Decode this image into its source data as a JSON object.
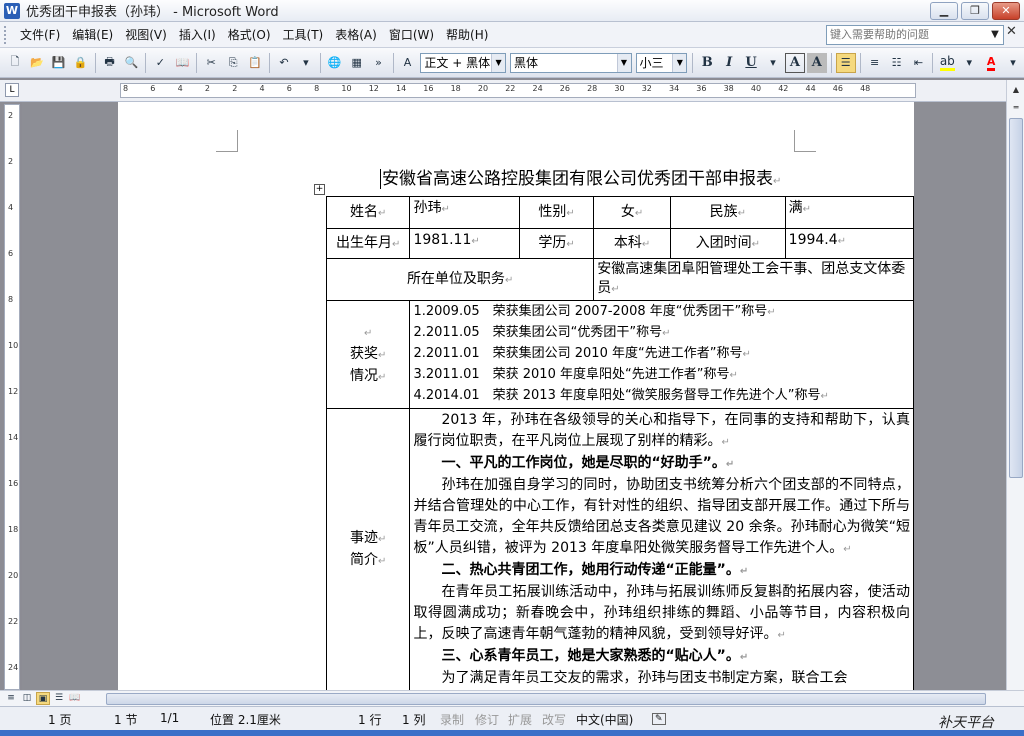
{
  "window": {
    "title": "优秀团干申报表（孙玮） - Microsoft Word",
    "app_icon": "W"
  },
  "menu": [
    "文件(F)",
    "编辑(E)",
    "视图(V)",
    "插入(I)",
    "格式(O)",
    "工具(T)",
    "表格(A)",
    "窗口(W)",
    "帮助(H)"
  ],
  "help_placeholder": "键入需要帮助的问题",
  "toolbar": {
    "style": "正文 + 黑体",
    "font": "黑体",
    "size": "小三",
    "bold": "B",
    "italic": "I",
    "underline": "U",
    "char_border": "A",
    "char_shade": "A",
    "highlight_color": "#ffff00",
    "font_color": "#ff0000"
  },
  "ruler": {
    "h_ticks": [
      "8",
      "6",
      "4",
      "2",
      "2",
      "4",
      "6",
      "8",
      "10",
      "12",
      "14",
      "16",
      "18",
      "20",
      "22",
      "24",
      "26",
      "28",
      "30",
      "32",
      "34",
      "36",
      "38",
      "40",
      "42",
      "44",
      "46",
      "48"
    ],
    "v_ticks": [
      "2",
      "2",
      "4",
      "6",
      "8",
      "10",
      "12",
      "14",
      "16",
      "18",
      "20",
      "22",
      "24"
    ],
    "tab_selector": "L"
  },
  "doc": {
    "title": "安徽省高速公路控股集团有限公司优秀团干部申报表",
    "label_name": "姓名",
    "name": "孙玮",
    "label_gender": "性别",
    "gender": "女",
    "label_ethnic": "民族",
    "ethnic": "满",
    "label_birth": "出生年月",
    "birth": "1981.11",
    "label_edu": "学历",
    "edu": "本科",
    "label_join": "入团时间",
    "join": "1994.4",
    "label_unit": "所在单位及职务",
    "unit": "安徽高速集团阜阳管理处工会干事、团总支文体委员",
    "label_awards_1": "获奖",
    "label_awards_2": "情况",
    "awards": [
      "1.2009.05　荣获集团公司 2007-2008 年度“优秀团干”称号",
      "2.2011.05　荣获集团公司“优秀团干”称号",
      "2.2011.01　荣获集团公司 2010 年度“先进工作者”称号",
      "3.2011.01　荣获 2010 年度阜阳处“先进工作者”称号",
      "4.2014.01　荣获 2013 年度阜阳处“微笑服务督导工作先进个人”称号"
    ],
    "label_story_1": "事迹",
    "label_story_2": "简介",
    "story": {
      "p1": "2013 年，孙玮在各级领导的关心和指导下，在同事的支持和帮助下，认真履行岗位职责，在平凡岗位上展现了别样的精彩。",
      "h1": "一、平凡的工作岗位，她是尽职的“好助手”。",
      "p2": "孙玮在加强自身学习的同时，协助团支书统筹分析六个团支部的不同特点，并结合管理处的中心工作，有针对性的组织、指导团支部开展工作。通过下所与青年员工交流，全年共反馈给团总支各类意见建议 20 余条。孙玮耐心为微笑“短板”人员纠错，被评为 2013 年度阜阳处微笑服务督导工作先进个人。",
      "h2": "二、热心共青团工作，她用行动传递“正能量”。",
      "p3": "在青年员工拓展训练活动中，孙玮与拓展训练师反复斟酌拓展内容，使活动取得圆满成功；新春晚会中，孙玮组织排练的舞蹈、小品等节目，内容积极向上，反映了高速青年朝气蓬勃的精神风貌，受到领导好评。",
      "h3": "三、心系青年员工，她是大家熟悉的“贴心人”。",
      "p4": "为了满足青年员工交友的需求，孙玮与团支书制定方案，联合工会"
    }
  },
  "status": {
    "page": "1 页",
    "section": "1 节",
    "pages": "1/1",
    "position": "位置 2.1厘米",
    "line": "1 行",
    "col": "1 列",
    "rec": "录制",
    "trk": "修订",
    "ext": "扩展",
    "ovr": "改写",
    "lang": "中文(中国)"
  },
  "watermark": "补天平台"
}
